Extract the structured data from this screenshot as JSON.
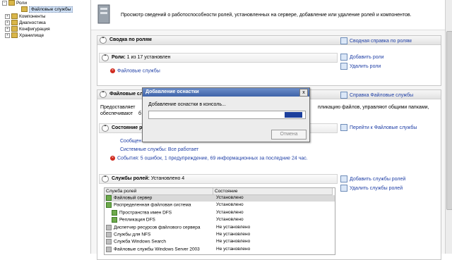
{
  "tree": {
    "items": [
      {
        "label": "Роли"
      },
      {
        "label": "Файловые службы"
      },
      {
        "label": "Компоненты"
      },
      {
        "label": "Диагностика"
      },
      {
        "label": "Конфигурация"
      },
      {
        "label": "Хранилище"
      }
    ]
  },
  "header": {
    "description": "Просмотр сведений о работоспособности ролей, установленных на сервере, добавление или удаление ролей и компонентов."
  },
  "summary": {
    "title": "Сводка по ролям",
    "help_link": "Сводная справка по ролям",
    "roles_label": "Роли",
    "roles_count": "1 из 17 установлен",
    "role_item": "Файловые службы",
    "add_roles": "Добавить роли",
    "remove_roles": "Удалить роли"
  },
  "fileservices": {
    "title": "Файловые служб",
    "help_link": "Справка Файловые службы",
    "desc1": "Предоставляет",
    "desc1_tail": "пликацию файлов, управляют общими папками,",
    "desc2": "обеспечивают",
    "desc2_tail": "б",
    "status_title": "Состояние р",
    "goto_link": "Перейти к Файловые службы",
    "messages": "Сообщен",
    "system_services": "Системные службы: Все работает",
    "events": "События: 5 ошибок, 1 предупреждение, 69 информационных за последние 24 час."
  },
  "role_services": {
    "title": "Службы ролей:",
    "installed": "Установлено 4",
    "add_link": "Добавить службы ролей",
    "remove_link": "Удалить службы ролей",
    "columns": [
      "Служба ролей",
      "Состояние"
    ],
    "rows": [
      {
        "name": "Файловый сервер",
        "status": "Установлено",
        "state": "on",
        "indent": 0
      },
      {
        "name": "Распределенная файловая система",
        "status": "Установлено",
        "state": "on",
        "indent": 0
      },
      {
        "name": "Пространства имен DFS",
        "status": "Установлено",
        "state": "on",
        "indent": 1
      },
      {
        "name": "Репликация DFS",
        "status": "Установлено",
        "state": "on",
        "indent": 1
      },
      {
        "name": "Диспетчер ресурсов файлового сервера",
        "status": "Не установлено",
        "state": "off",
        "indent": 0
      },
      {
        "name": "Службы для NFS",
        "status": "Не установлено",
        "state": "off",
        "indent": 0
      },
      {
        "name": "Служба Windows Search",
        "status": "Не установлено",
        "state": "off",
        "indent": 0
      },
      {
        "name": "Файловые службы Windows Server 2003",
        "status": "Не установлено",
        "state": "off",
        "indent": 0
      }
    ]
  },
  "dialog": {
    "title": "Добавление оснастки",
    "close": "x",
    "message": "Добавление оснастки в консоль...",
    "cancel": "Отмена",
    "progress_segment_start": 0.87,
    "progress_segment_end": 0.98
  },
  "colors": {
    "error": "#d02a1e",
    "link": "#1f3fa6",
    "progress": "#1c3f9c"
  }
}
